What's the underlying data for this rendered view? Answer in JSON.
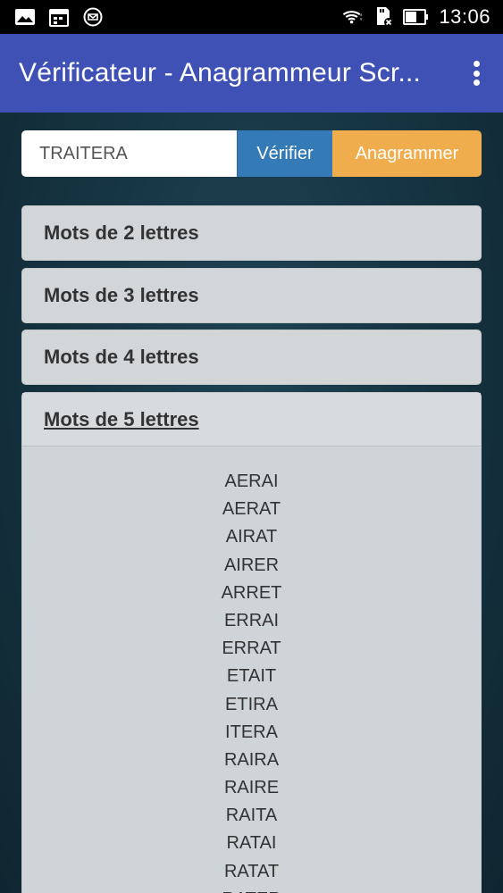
{
  "status_bar": {
    "time": "13:06"
  },
  "app_bar": {
    "title": "Vérificateur - Anagrammeur Scr..."
  },
  "search": {
    "value": "TRAITERA",
    "verify_label": "Vérifier",
    "anagram_label": "Anagrammer"
  },
  "accordion": {
    "panels": [
      {
        "label": "Mots de 2 lettres"
      },
      {
        "label": "Mots de 3 lettres"
      },
      {
        "label": "Mots de 4 lettres"
      },
      {
        "label": "Mots de 5 lettres"
      }
    ],
    "five_letter_words": [
      "AERAI",
      "AERAT",
      "AIRAT",
      "AIRER",
      "ARRET",
      "ERRAI",
      "ERRAT",
      "ETAIT",
      "ETIRA",
      "ITERA",
      "RAIRA",
      "RAIRE",
      "RAITA",
      "RATAI",
      "RATAT",
      "RATER"
    ]
  },
  "colors": {
    "app_bar": "#3f51b5",
    "verify_button": "#337ab7",
    "anagram_button": "#f0ad4e",
    "panel": "#d3d6d8"
  }
}
